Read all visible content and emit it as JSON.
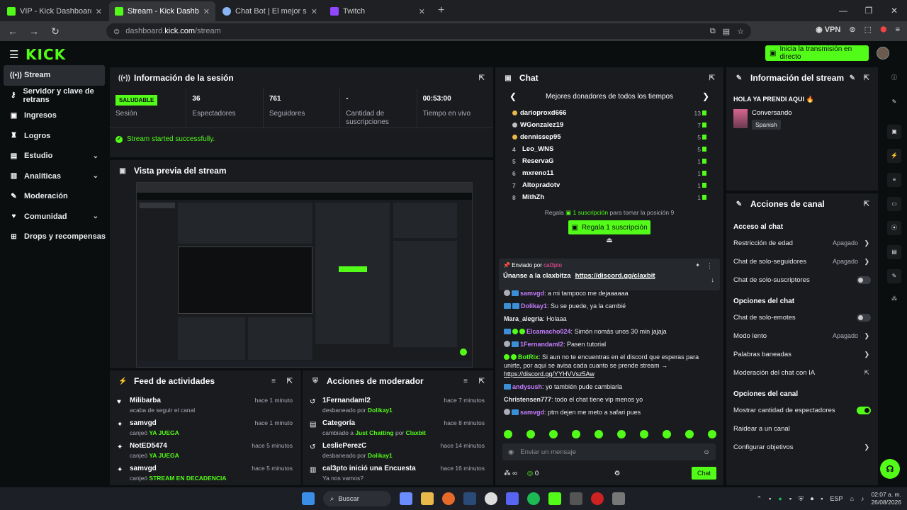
{
  "browser": {
    "tabs": [
      {
        "title": "VIP - Kick Dashboard",
        "fav": "kick"
      },
      {
        "title": "Stream - Kick Dashboard",
        "fav": "kick",
        "active": true
      },
      {
        "title": "Chat Bot | El mejor software pa",
        "fav": "chatbot"
      },
      {
        "title": "Twitch",
        "fav": "twitch"
      }
    ],
    "url_prefix": "dashboard.",
    "url_domain": "kick.com",
    "url_path": "/stream",
    "vpn_label": "VPN"
  },
  "header": {
    "logo": "KICK",
    "go_live": "Inicia la transmisión en directo"
  },
  "sidebar": {
    "items": [
      {
        "label": "Stream",
        "icon": "broadcast-icon",
        "glyph": "((•))",
        "active": true
      },
      {
        "label": "Servidor y clave de retrans",
        "icon": "key-icon",
        "glyph": "⚷"
      },
      {
        "label": "Ingresos",
        "icon": "money-icon",
        "glyph": "▣"
      },
      {
        "label": "Logros",
        "icon": "trophy-icon",
        "glyph": "♜"
      },
      {
        "label": "Estudio",
        "icon": "studio-icon",
        "glyph": "▤",
        "chevron": true
      },
      {
        "label": "Analíticas",
        "icon": "chart-icon",
        "glyph": "▥",
        "chevron": true
      },
      {
        "label": "Moderación",
        "icon": "wrench-icon",
        "glyph": "✎"
      },
      {
        "label": "Comunidad",
        "icon": "community-icon",
        "glyph": "♥",
        "chevron": true
      },
      {
        "label": "Drops y recompensas",
        "icon": "gift-icon",
        "glyph": "⊞"
      }
    ]
  },
  "session": {
    "title": "Información de la sesión",
    "status_badge": "SALUDABLE",
    "stats": [
      {
        "value": "",
        "label": "Sesión",
        "badge": true
      },
      {
        "value": "36",
        "label": "Espectadores"
      },
      {
        "value": "761",
        "label": "Seguidores"
      },
      {
        "value": "-",
        "label": "Cantidad de suscripciones"
      },
      {
        "value": "00:53:00",
        "label": "Tiempo en vivo"
      }
    ],
    "started_msg": "Stream started successfully."
  },
  "preview": {
    "title": "Vista previa del stream"
  },
  "feed": {
    "title": "Feed de actividades",
    "items": [
      {
        "name": "Milibarba",
        "pre": "acaba de seguir el canal",
        "hl": "",
        "time": "hace 1 minuto",
        "icon": "heart-icon",
        "glyph": "♥"
      },
      {
        "name": "samvgd",
        "pre": "canjeó ",
        "hl": "YA JUEGA",
        "time": "hace 1 minuto",
        "icon": "reward-icon",
        "glyph": "✦"
      },
      {
        "name": "NotED5474",
        "pre": "canjeó ",
        "hl": "YA JUEGA",
        "time": "hace 5 minutos",
        "icon": "reward-icon",
        "glyph": "✦"
      },
      {
        "name": "samvgd",
        "pre": "canjeó ",
        "hl": "STREAM EN DECADENCIA",
        "time": "hace 5 minutos",
        "icon": "reward-icon",
        "glyph": "✦"
      }
    ]
  },
  "modactions": {
    "title": "Acciones de moderador",
    "items": [
      {
        "name": "1Fernandaml2",
        "sub": "desbaneado por ",
        "hl": "Dolikay1",
        "sub2": "",
        "hl2": "",
        "time": "hace 7 minutos",
        "icon": "unban-icon",
        "glyph": "↺"
      },
      {
        "name": "Categoría",
        "sub": "cambiado a ",
        "hl": "Just Chatting",
        "sub2": " por ",
        "hl2": "Claxbit",
        "time": "hace 8 minutos",
        "icon": "category-icon",
        "glyph": "▤"
      },
      {
        "name": "LesliePerezC",
        "sub": "desbaneado por ",
        "hl": "Dolikay1",
        "sub2": "",
        "hl2": "",
        "time": "hace 14 minutos",
        "icon": "unban-icon",
        "glyph": "↺"
      },
      {
        "name": "cal3pto inició una Encuesta",
        "sub": "Ya nos vamos?",
        "hl": "",
        "sub2": "",
        "hl2": "",
        "time": "hace 16 minutos",
        "icon": "poll-icon",
        "glyph": "▥"
      }
    ]
  },
  "chat": {
    "title": "Chat",
    "donors_title": "Mejores donadores de todos los tiempos",
    "donors": [
      {
        "rank": "",
        "coin": "gold",
        "name": "darioproxd666",
        "count": "13"
      },
      {
        "rank": "",
        "coin": "silver",
        "name": "WGonzalez19",
        "count": "7"
      },
      {
        "rank": "",
        "coin": "gold",
        "name": "dennissep95",
        "count": "5"
      },
      {
        "rank": "4",
        "coin": "",
        "name": "Leo_WNS",
        "count": "5"
      },
      {
        "rank": "5",
        "coin": "",
        "name": "ReservaG",
        "count": "1"
      },
      {
        "rank": "6",
        "coin": "",
        "name": "mxreno11",
        "count": "1"
      },
      {
        "rank": "7",
        "coin": "",
        "name": "Altopradotv",
        "count": "1"
      },
      {
        "rank": "8",
        "coin": "",
        "name": "MithZh",
        "count": "1"
      }
    ],
    "regala_pre": "Regala ",
    "regala_hl": "1 suscripción",
    "regala_post": " para tomar la posición 9",
    "regala_btn": "Regala 1 suscripción",
    "pinned_by": "Enviado por",
    "pinned_user": "cal3pto",
    "pinned_msg": "Únanse a la claxbitza",
    "pinned_link": "https://discord.gg/claxbit",
    "messages": [
      {
        "badges": [
          "n",
          "b"
        ],
        "user": "samvgd",
        "color": "#c77dff",
        "text": "a mi tampoco me dejaaaaaa",
        "link": ""
      },
      {
        "badges": [
          "b",
          "b"
        ],
        "user": "Dolikay1",
        "color": "#c77dff",
        "text": "Su se puede, ya la cambié",
        "link": ""
      },
      {
        "badges": [],
        "user": "Mara_alegria",
        "color": "#e8eaed",
        "text": "Holaaa",
        "link": ""
      },
      {
        "badges": [
          "b",
          "g",
          "g"
        ],
        "user": "Elcamacho024",
        "color": "#c77dff",
        "text": "Simón nomás unos 30 min jajaja",
        "link": ""
      },
      {
        "badges": [
          "n",
          "b"
        ],
        "user": "1Fernandaml2",
        "color": "#c77dff",
        "text": "Pasen tutorial",
        "link": ""
      },
      {
        "badges": [
          "g",
          "g"
        ],
        "user": "BotRix",
        "color": "#53fc18",
        "text": "Si aun no te encuentras en el discord que esperas para unirte, por aqui se avisa cada cuanto se prende stream → ",
        "link": "https://discord.gg/YYHVVsz5Aw"
      },
      {
        "badges": [
          "b"
        ],
        "user": "andysush",
        "color": "#c77dff",
        "text": "yo también pude cambiarla",
        "link": ""
      },
      {
        "badges": [],
        "user": "Christensen777",
        "color": "#e8eaed",
        "text": "todo el chat tiene vip menos yo",
        "link": ""
      },
      {
        "badges": [
          "n",
          "b"
        ],
        "user": "samvgd",
        "color": "#c77dff",
        "text": "ptm dejen me meto a safari pues",
        "link": ""
      }
    ],
    "input_placeholder": "Enviar un mensaje",
    "points": "0",
    "send_label": "Chat"
  },
  "stream_info": {
    "title": "Información del stream",
    "stream_title": "HOLA YA PRENDI AQUI 🔥",
    "category": "Conversando",
    "language": "Spanish"
  },
  "channel_actions": {
    "title": "Acciones de canal",
    "sections": [
      {
        "heading": "Acceso al chat",
        "rows": [
          {
            "label": "Restricción de edad",
            "value": "Apagado",
            "kind": "arrow"
          },
          {
            "label": "Chat de solo-seguidores",
            "value": "Apagado",
            "kind": "arrow"
          },
          {
            "label": "Chat de solo-suscriptores",
            "value": "",
            "kind": "toggle-off"
          }
        ]
      },
      {
        "heading": "Opciones del chat",
        "rows": [
          {
            "label": "Chat de solo-emotes",
            "value": "",
            "kind": "toggle-off"
          },
          {
            "label": "Modo lento",
            "value": "Apagado",
            "kind": "arrow"
          },
          {
            "label": "Palabras baneadas",
            "value": "",
            "kind": "arrow"
          },
          {
            "label": "Moderación del chat con IA",
            "value": "",
            "kind": "external"
          }
        ]
      },
      {
        "heading": "Opciones del canal",
        "rows": [
          {
            "label": "Mostrar cantidad de espectadores",
            "value": "",
            "kind": "toggle-on"
          },
          {
            "label": "Raidear a un canal",
            "value": "",
            "kind": "none"
          },
          {
            "label": "Configurar objetivos",
            "value": "",
            "kind": "arrow"
          }
        ]
      }
    ]
  },
  "taskbar": {
    "search_label": "Buscar",
    "lang": "ESP",
    "time": "02:07 a. m.",
    "date": "26/08/2026"
  },
  "colors": {
    "accent": "#53fc18",
    "panel": "#191b1f",
    "bg": "#0b0e0f"
  }
}
